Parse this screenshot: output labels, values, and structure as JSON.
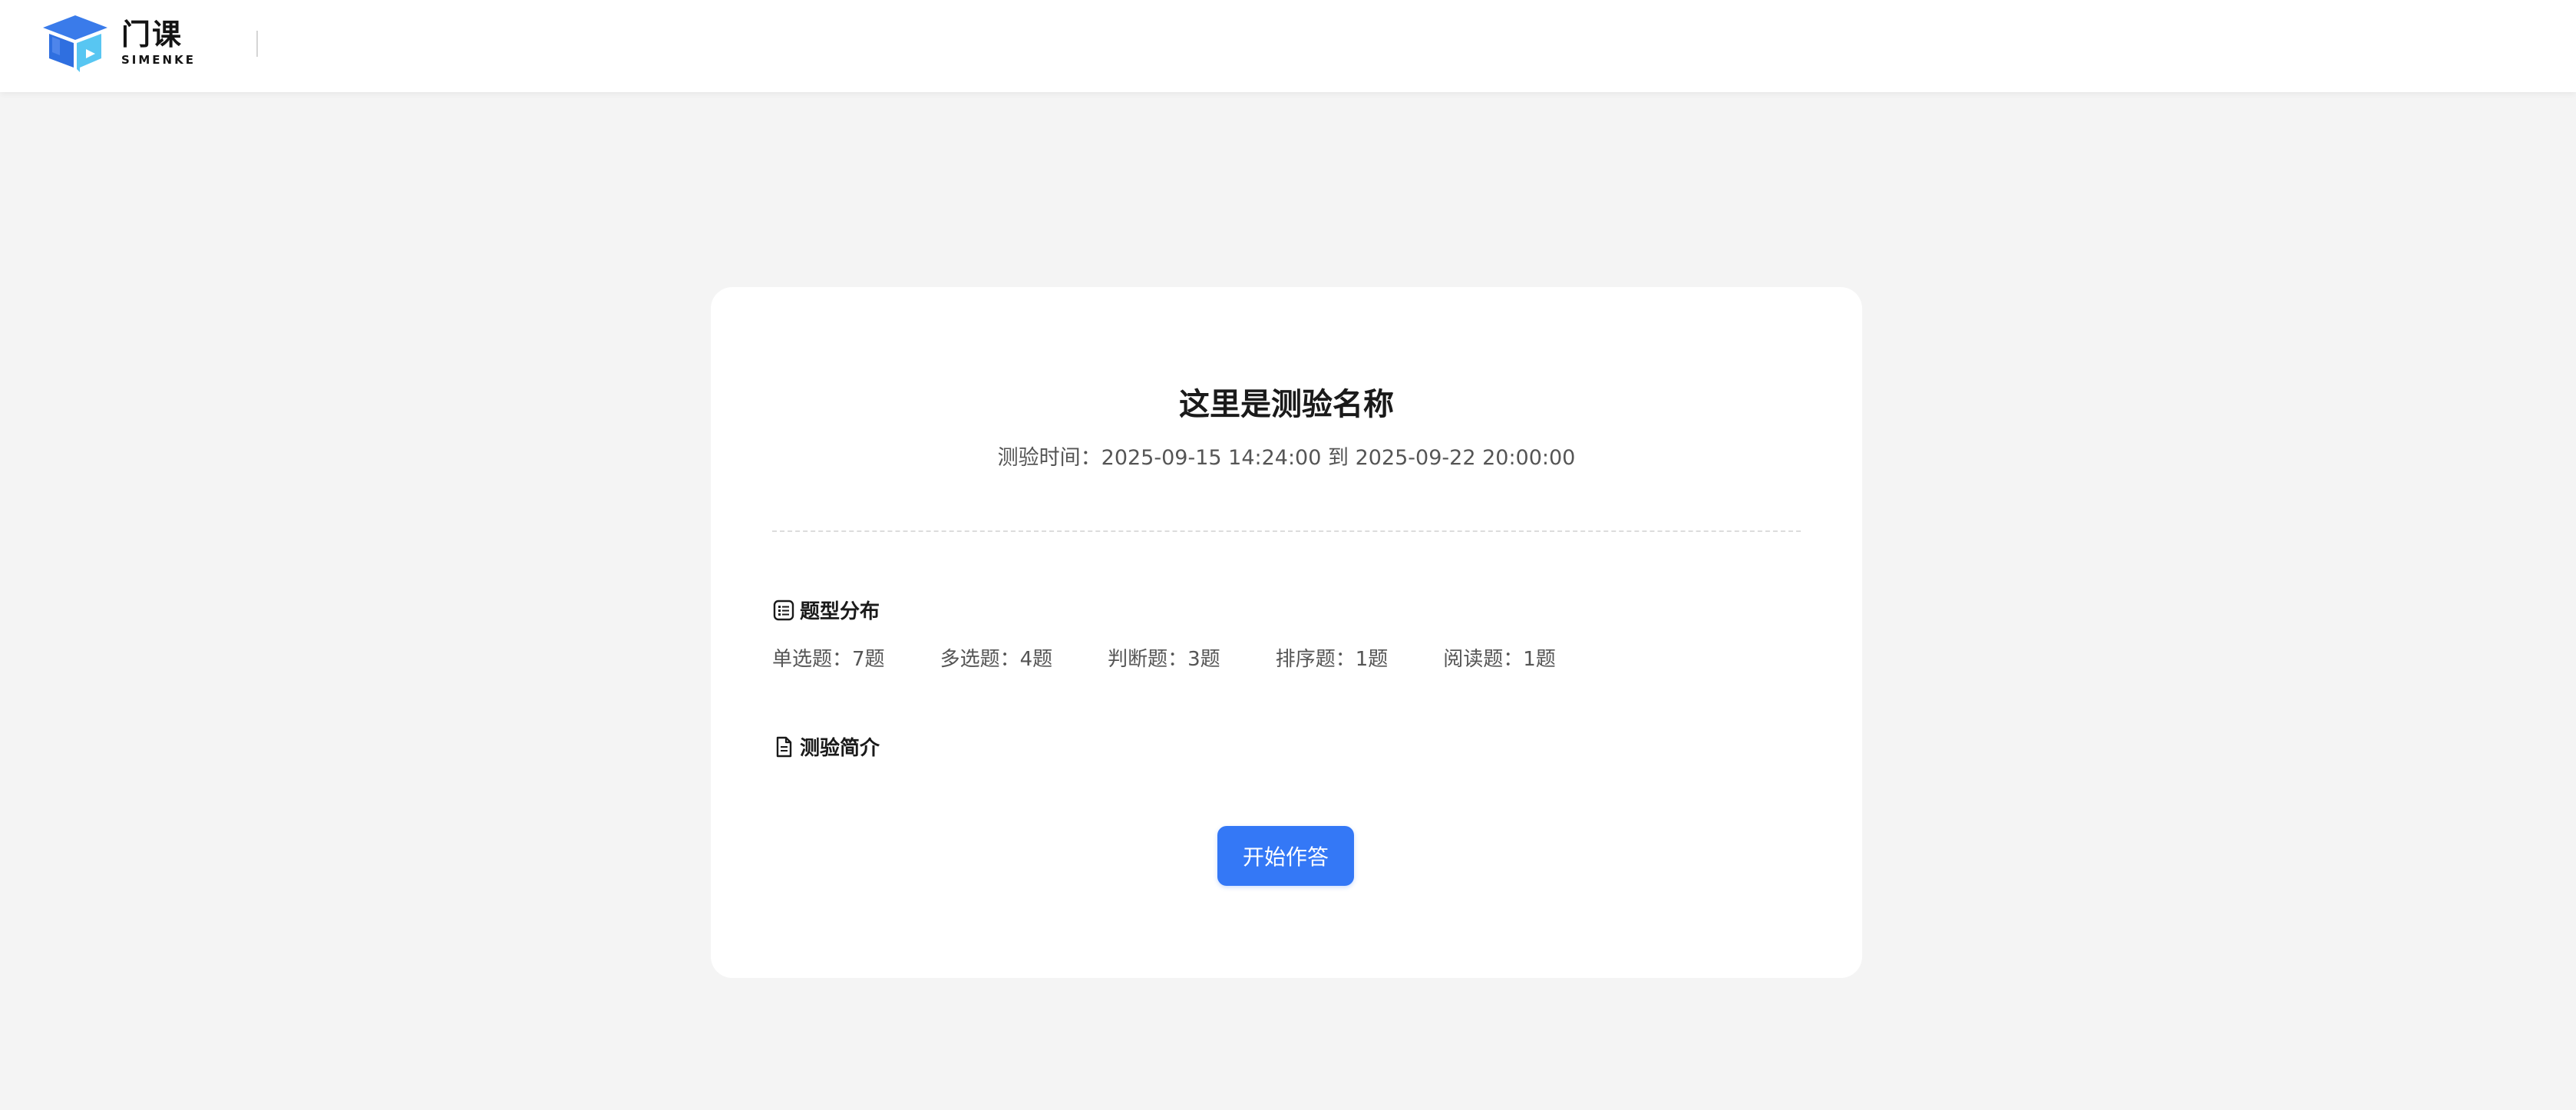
{
  "header": {
    "brand_title": "门课",
    "brand_subtitle": "SIMENKE",
    "accent_color": "#3478f6"
  },
  "quiz": {
    "title": "这里是测验名称",
    "time_label": "测验时间：",
    "start_time": "2025-09-15 14:24:00",
    "time_separator": "到",
    "end_time": "2025-09-22 20:00:00"
  },
  "distribution": {
    "heading": "题型分布",
    "icon": "list-icon",
    "items": [
      {
        "label": "单选题：",
        "count": "7题"
      },
      {
        "label": "多选题：",
        "count": "4题"
      },
      {
        "label": "判断题：",
        "count": "3题"
      },
      {
        "label": "排序题：",
        "count": "1题"
      },
      {
        "label": "阅读题：",
        "count": "1题"
      }
    ]
  },
  "intro": {
    "heading": "测验简介",
    "icon": "document-icon"
  },
  "actions": {
    "start_label": "开始作答"
  }
}
